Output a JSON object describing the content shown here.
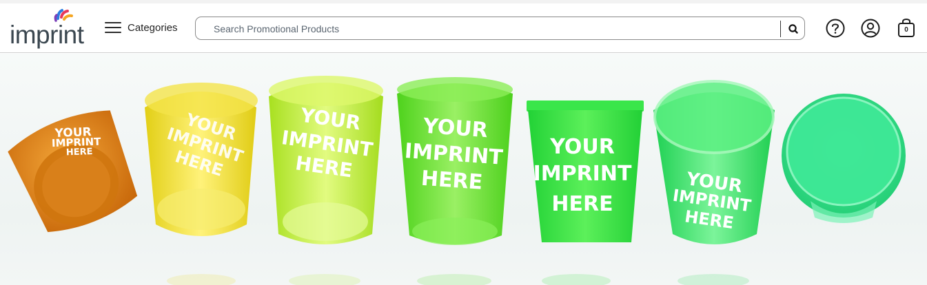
{
  "brand": {
    "name": "imprint",
    "colors": [
      "#e8395a",
      "#f5a623",
      "#2a7de1",
      "#7b3fb8"
    ]
  },
  "header": {
    "categories_label": "Categories",
    "search": {
      "placeholder": "Search Promotional Products",
      "value": ""
    },
    "bag_count": "0",
    "icons": [
      "menu-icon",
      "search-icon",
      "help-icon",
      "account-icon",
      "bag-icon"
    ]
  },
  "hero": {
    "cup_imprint": [
      "YOUR",
      "IMPRINT",
      "HERE"
    ],
    "cup_colors": [
      "#e88a10",
      "#f2e024",
      "#c8f03a",
      "#6fe43a",
      "#3fe848",
      "#33e05a",
      "#3fe88a"
    ]
  }
}
